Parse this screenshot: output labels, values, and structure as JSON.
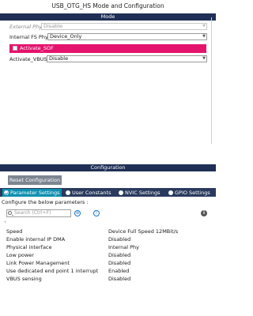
{
  "title": "USB_OTG_HS Mode and Configuration",
  "mode_header": "Mode",
  "mode_fields": [
    {
      "label": "External Phy",
      "value": "Disable",
      "disabled": true
    },
    {
      "label": "Internal FS Phy",
      "value": "Device_Only",
      "disabled": false
    }
  ],
  "activate_sof": {
    "label": "Activate_SOF",
    "checked": false
  },
  "activate_vbus": {
    "label": "Activate_VBUS",
    "value": "Disable"
  },
  "config_header": "Configuration",
  "reset_button": "Reset Configuration",
  "tabs": [
    {
      "label": "Parameter Settings",
      "active": true
    },
    {
      "label": "User Constants",
      "active": false
    },
    {
      "label": "NVIC Settings",
      "active": false
    },
    {
      "label": "GPIO Settings",
      "active": false
    }
  ],
  "configure_text": "Configure the below parameters :",
  "search": {
    "placeholder": "Search (Ctrl+F)"
  },
  "params": [
    {
      "name": "Speed",
      "value": "Device Full Speed 12MBit/s"
    },
    {
      "name": "Enable internal IP DMA",
      "value": "Disabled"
    },
    {
      "name": "Physical interface",
      "value": "Internal Phy"
    },
    {
      "name": "Low power",
      "value": "Disabled"
    },
    {
      "name": "Link Power Management",
      "value": "Disabled"
    },
    {
      "name": "Use dedicated end point 1 interrupt",
      "value": "Enabled"
    },
    {
      "name": "VBUS sensing",
      "value": "Disabled"
    }
  ]
}
